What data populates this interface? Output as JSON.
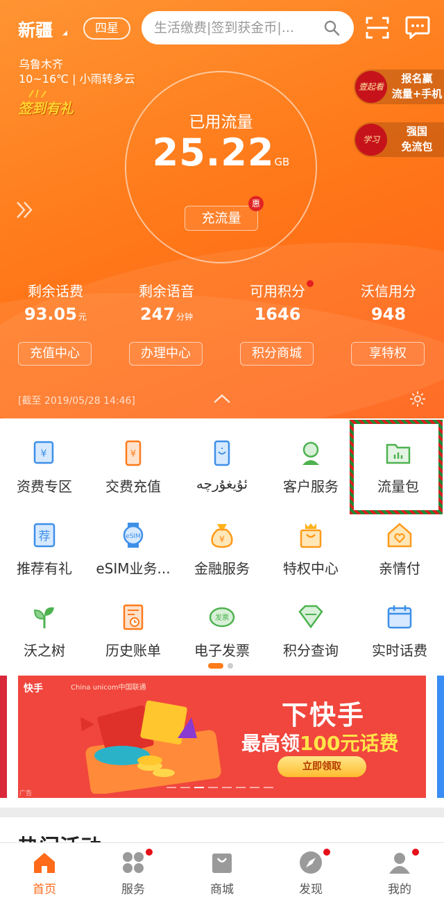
{
  "header": {
    "region": "新疆",
    "star_level": "四星",
    "search_placeholder": "生活缴费|签到获金币|...",
    "city": "乌鲁木齐",
    "weather": "10~16℃ | 小雨转多云",
    "signin_label": "签到有礼"
  },
  "data_usage": {
    "title": "已用流量",
    "value": "25.22",
    "unit": "GB",
    "button_label": "充流量",
    "badge": "惠"
  },
  "promos": [
    {
      "line1": "报名赢",
      "line2": "流量+手机",
      "logo": "壹起看"
    },
    {
      "line1": "强国",
      "line2": "免流包",
      "logo": "学习"
    }
  ],
  "stats": [
    {
      "label": "剩余话费",
      "value": "93.05",
      "unit": "元"
    },
    {
      "label": "剩余语音",
      "value": "247",
      "unit": "分钟"
    },
    {
      "label": "可用积分",
      "value": "1646",
      "unit": ""
    },
    {
      "label": "沃信用分",
      "value": "948",
      "unit": ""
    }
  ],
  "actions": [
    "充值中心",
    "办理中心",
    "积分商城",
    "享特权"
  ],
  "as_of": "[截至 2019/05/28 14:46]",
  "services": [
    {
      "label": "资费专区",
      "icon": "price-tag-icon"
    },
    {
      "label": "交费充值",
      "icon": "phone-yuan-icon"
    },
    {
      "label": "ئۇيغۇرچە",
      "icon": "uyghur-phone-icon"
    },
    {
      "label": "客户服务",
      "icon": "customer-service-icon"
    },
    {
      "label": "流量包",
      "icon": "data-folder-icon"
    },
    {
      "label": "推荐有礼",
      "icon": "recommend-icon"
    },
    {
      "label": "eSIM业务...",
      "icon": "esim-watch-icon"
    },
    {
      "label": "金融服务",
      "icon": "money-bag-icon"
    },
    {
      "label": "特权中心",
      "icon": "crown-bag-icon"
    },
    {
      "label": "亲情付",
      "icon": "family-house-icon"
    },
    {
      "label": "沃之树",
      "icon": "sprout-icon"
    },
    {
      "label": "历史账单",
      "icon": "bill-history-icon"
    },
    {
      "label": "电子发票",
      "icon": "e-invoice-icon"
    },
    {
      "label": "积分查询",
      "icon": "diamond-icon"
    },
    {
      "label": "实时话费",
      "icon": "calendar-icon"
    }
  ],
  "banner": {
    "brand": "快手",
    "partner": "China unicom中国联通",
    "title": "下快手",
    "subtitle_pre": "最高领",
    "subtitle_highlight": "100元话费",
    "cta": "立即领取",
    "ad_tag": "广告"
  },
  "section_title": "热门活动",
  "tabs": [
    {
      "label": "首页",
      "icon": "home-icon",
      "active": true,
      "dot": false
    },
    {
      "label": "服务",
      "icon": "services-grid-icon",
      "active": false,
      "dot": true
    },
    {
      "label": "商城",
      "icon": "shopping-bag-icon",
      "active": false,
      "dot": false
    },
    {
      "label": "发现",
      "icon": "compass-icon",
      "active": false,
      "dot": true
    },
    {
      "label": "我的",
      "icon": "profile-icon",
      "active": false,
      "dot": true
    }
  ],
  "colors": {
    "brand_orange": "#ff7a1a",
    "badge_red": "#e52020",
    "icon_blue": "#3d8fe8",
    "icon_green": "#4db24f",
    "icon_orange": "#ff8c1a"
  }
}
